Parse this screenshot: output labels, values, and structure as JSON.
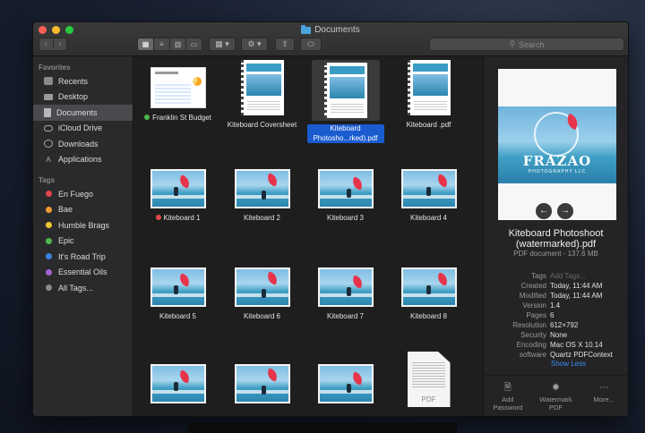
{
  "window": {
    "title": "Documents",
    "search_placeholder": "Search"
  },
  "toolbar": {
    "back": "‹",
    "forward": "›",
    "views": [
      "▦",
      "≡",
      "▥",
      "▭"
    ]
  },
  "sidebar": {
    "favorites_header": "Favorites",
    "favorites": [
      {
        "label": "Recents",
        "icon": "recents-icon"
      },
      {
        "label": "Desktop",
        "icon": "desktop-icon"
      },
      {
        "label": "Documents",
        "icon": "documents-icon",
        "selected": true
      },
      {
        "label": "iCloud Drive",
        "icon": "icloud-icon"
      },
      {
        "label": "Downloads",
        "icon": "downloads-icon"
      },
      {
        "label": "Applications",
        "icon": "applications-icon"
      }
    ],
    "tags_header": "Tags",
    "tags": [
      {
        "label": "En Fuego",
        "color": "#e0474c"
      },
      {
        "label": "Bae",
        "color": "#f29a38"
      },
      {
        "label": "Humble Brags",
        "color": "#f0c832"
      },
      {
        "label": "Epic",
        "color": "#4cb84c"
      },
      {
        "label": "It's Road Trip",
        "color": "#3b82e6"
      },
      {
        "label": "Essential Oils",
        "color": "#a462d4"
      },
      {
        "label": "All Tags...",
        "color": "#8a8a8a"
      }
    ]
  },
  "files": [
    {
      "label": "Franklin St Budget",
      "kind": "sheet",
      "tag_color": "#4cb84c"
    },
    {
      "label": "Kiteboard Coversheet",
      "kind": "doc"
    },
    {
      "label": "Kiteboard Photosho...rked).pdf",
      "kind": "doc",
      "selected": true
    },
    {
      "label": "Kiteboard .pdf",
      "kind": "doc"
    },
    {
      "label": "Kiteboard 1",
      "kind": "photo",
      "tag_color": "#e0474c"
    },
    {
      "label": "Kiteboard 2",
      "kind": "photo"
    },
    {
      "label": "Kiteboard 3",
      "kind": "photo"
    },
    {
      "label": "Kiteboard 4",
      "kind": "photo"
    },
    {
      "label": "Kiteboard 5",
      "kind": "photo"
    },
    {
      "label": "Kiteboard 6",
      "kind": "photo"
    },
    {
      "label": "Kiteboard 7",
      "kind": "photo"
    },
    {
      "label": "Kiteboard 8",
      "kind": "photo"
    },
    {
      "label": "",
      "kind": "photo"
    },
    {
      "label": "",
      "kind": "photo"
    },
    {
      "label": "",
      "kind": "photo"
    },
    {
      "label": "",
      "kind": "pdf",
      "badge": "PDF"
    }
  ],
  "preview": {
    "brand": "FRAZAO",
    "brand_sub": "PHOTOGRAPHY LLC",
    "title": "Kiteboard Photoshoot (watermarked).pdf",
    "subtitle": "PDF document - 137.6 MB",
    "meta": [
      {
        "k": "Tags",
        "v": "Add Tags...",
        "placeholder": true
      },
      {
        "k": "Created",
        "v": "Today, 11:44 AM"
      },
      {
        "k": "Modified",
        "v": "Today, 11:44 AM"
      },
      {
        "k": "Version",
        "v": "1.4"
      },
      {
        "k": "Pages",
        "v": "6"
      },
      {
        "k": "Resolution",
        "v": "612×792"
      },
      {
        "k": "Security",
        "v": "None"
      },
      {
        "k": "Encoding",
        "v": "Mac OS X 10.14"
      },
      {
        "k": "software",
        "v": "Quartz PDFContext"
      }
    ],
    "show_less": "Show Less",
    "actions": [
      {
        "label": "Add Password",
        "icon": "document-lock-icon"
      },
      {
        "label": "Watermark PDF",
        "icon": "gear-icon"
      },
      {
        "label": "More...",
        "icon": "more-icon"
      }
    ]
  }
}
